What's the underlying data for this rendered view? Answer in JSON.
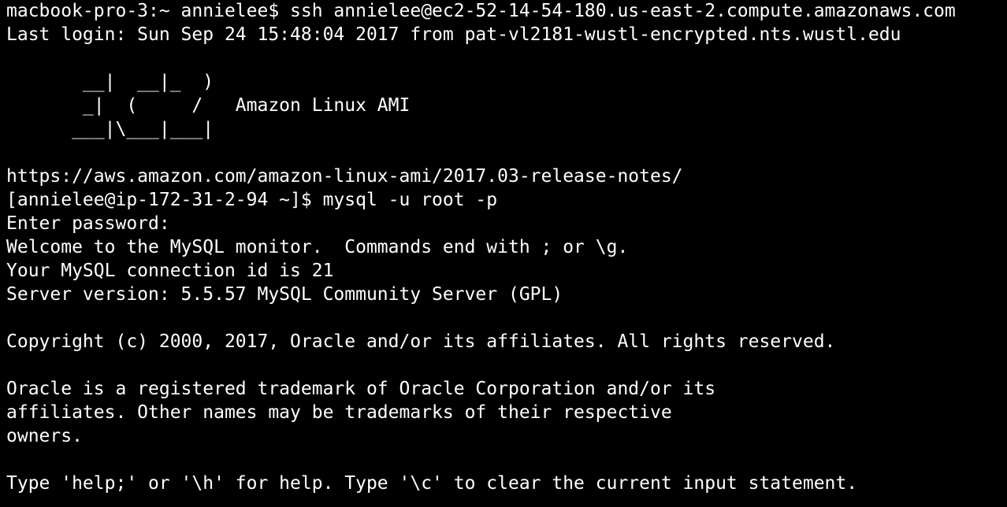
{
  "terminal": {
    "background": "#000000",
    "foreground": "#ffffff",
    "lines": [
      "macbook-pro-3:~ annielee$ ssh annielee@ec2-52-14-54-180.us-east-2.compute.amazonaws.com",
      "Last login: Sun Sep 24 15:48:04 2017 from pat-vl2181-wustl-encrypted.nts.wustl.edu",
      "",
      "       __|  __|_  )",
      "       _|  (     /   Amazon Linux AMI",
      "      ___|\\___|___|",
      "",
      "https://aws.amazon.com/amazon-linux-ami/2017.03-release-notes/",
      "[annielee@ip-172-31-2-94 ~]$ mysql -u root -p",
      "Enter password:",
      "Welcome to the MySQL monitor.  Commands end with ; or \\g.",
      "Your MySQL connection id is 21",
      "Server version: 5.5.57 MySQL Community Server (GPL)",
      "",
      "Copyright (c) 2000, 2017, Oracle and/or its affiliates. All rights reserved.",
      "",
      "Oracle is a registered trademark of Oracle Corporation and/or its",
      "affiliates. Other names may be trademarks of their respective",
      "owners.",
      "",
      "Type 'help;' or '\\h' for help. Type '\\c' to clear the current input statement.",
      ""
    ]
  }
}
